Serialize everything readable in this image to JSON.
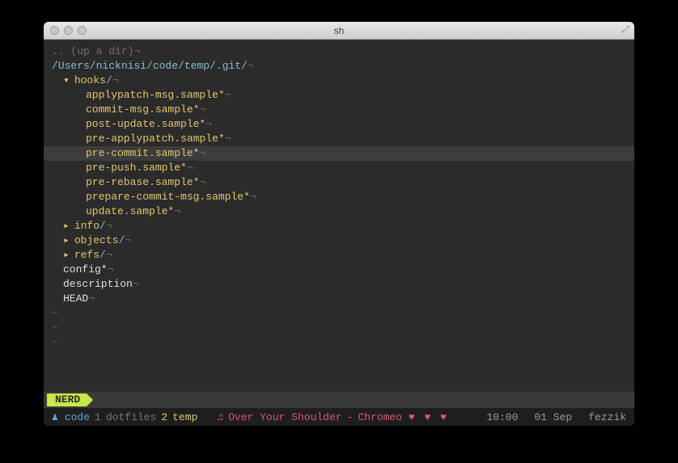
{
  "window": {
    "title": "sh"
  },
  "editor": {
    "up_label": ".. (up a dir)",
    "cwd": "/Users/nicknisi/code/temp/.git/",
    "eol": "¬",
    "tree": [
      {
        "type": "dir-open",
        "name": "hooks",
        "indent": 1,
        "children": [
          {
            "type": "file",
            "name": "applypatch-msg.sample*"
          },
          {
            "type": "file",
            "name": "commit-msg.sample*"
          },
          {
            "type": "file",
            "name": "post-update.sample*"
          },
          {
            "type": "file",
            "name": "pre-applypatch.sample*"
          },
          {
            "type": "file",
            "name": "pre-commit.sample*",
            "selected": true
          },
          {
            "type": "file",
            "name": "pre-push.sample*"
          },
          {
            "type": "file",
            "name": "pre-rebase.sample*"
          },
          {
            "type": "file",
            "name": "prepare-commit-msg.sample*"
          },
          {
            "type": "file",
            "name": "update.sample*"
          }
        ]
      },
      {
        "type": "dir-closed",
        "name": "info",
        "indent": 1
      },
      {
        "type": "dir-closed",
        "name": "objects",
        "indent": 1
      },
      {
        "type": "dir-closed",
        "name": "refs",
        "indent": 1
      },
      {
        "type": "entry",
        "name": "config*",
        "indent": 1
      },
      {
        "type": "entry",
        "name": "description",
        "indent": 1
      },
      {
        "type": "entry",
        "name": "HEAD",
        "indent": 1
      }
    ],
    "tilde_rows": 3
  },
  "statusbar": {
    "mode": "NERD"
  },
  "tmux": {
    "session": "code",
    "windows": [
      {
        "index": "1",
        "name": "dotfiles"
      },
      {
        "index": "2",
        "name": "temp",
        "active": true
      }
    ],
    "music": {
      "title": "Over Your Shoulder",
      "sep": "-",
      "artist": "Chromeo",
      "hearts": "♥ ♥ ♥"
    },
    "time": "10:00",
    "date": "01 Sep",
    "host": "fezzik"
  }
}
